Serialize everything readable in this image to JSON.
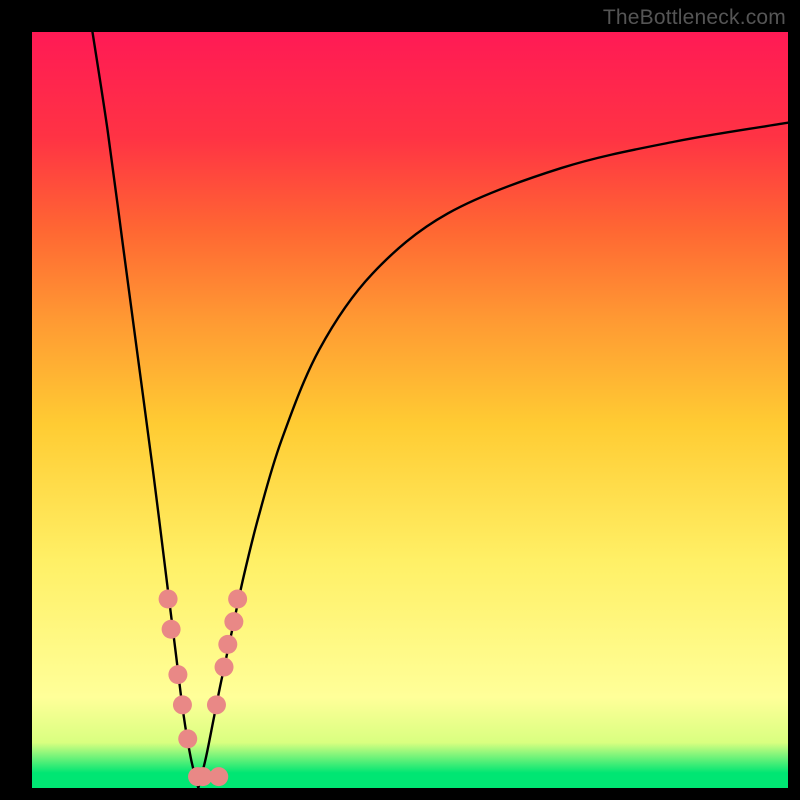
{
  "watermark": "TheBottleneck.com",
  "colors": {
    "page_bg": "#000000",
    "curve_stroke": "#000000",
    "dot_fill": "#e98886",
    "watermark_text": "#555555",
    "gradient_stops": [
      {
        "pos": 0.0,
        "hex": "#00e673"
      },
      {
        "pos": 0.02,
        "hex": "#00e673"
      },
      {
        "pos": 0.06,
        "hex": "#d9ff80"
      },
      {
        "pos": 0.12,
        "hex": "#ffff99"
      },
      {
        "pos": 0.3,
        "hex": "#fff066"
      },
      {
        "pos": 0.48,
        "hex": "#ffcc33"
      },
      {
        "pos": 0.62,
        "hex": "#ff9933"
      },
      {
        "pos": 0.74,
        "hex": "#ff6633"
      },
      {
        "pos": 0.86,
        "hex": "#ff3344"
      },
      {
        "pos": 1.0,
        "hex": "#ff1a55"
      }
    ]
  },
  "chart_data": {
    "type": "line",
    "title": "",
    "xlabel": "",
    "ylabel": "",
    "xlim": [
      0,
      100
    ],
    "ylim": [
      0,
      100
    ],
    "curve_min_x": 22,
    "series": [
      {
        "name": "left-branch",
        "x": [
          8.0,
          10.0,
          12.0,
          14.0,
          16.0,
          18.0,
          19.0,
          20.0,
          21.0,
          22.0
        ],
        "y": [
          100.0,
          87.0,
          72.0,
          57.0,
          42.0,
          26.0,
          18.0,
          10.0,
          4.0,
          0.0
        ]
      },
      {
        "name": "right-branch",
        "x": [
          22.0,
          23.0,
          24.0,
          25.0,
          26.5,
          28.0,
          30.0,
          33.0,
          38.0,
          45.0,
          55.0,
          70.0,
          85.0,
          100.0
        ],
        "y": [
          0.0,
          4.0,
          9.0,
          14.0,
          21.0,
          28.0,
          36.0,
          46.0,
          58.0,
          68.0,
          76.0,
          82.0,
          85.5,
          88.0
        ]
      }
    ],
    "dots": [
      {
        "x": 18.0,
        "y": 25.0
      },
      {
        "x": 18.4,
        "y": 21.0
      },
      {
        "x": 19.3,
        "y": 15.0
      },
      {
        "x": 19.9,
        "y": 11.0
      },
      {
        "x": 20.6,
        "y": 6.5
      },
      {
        "x": 21.9,
        "y": 1.5
      },
      {
        "x": 22.6,
        "y": 1.5
      },
      {
        "x": 24.7,
        "y": 1.5
      },
      {
        "x": 24.4,
        "y": 11.0
      },
      {
        "x": 25.4,
        "y": 16.0
      },
      {
        "x": 25.9,
        "y": 19.0
      },
      {
        "x": 26.7,
        "y": 22.0
      },
      {
        "x": 27.2,
        "y": 25.0
      }
    ]
  }
}
